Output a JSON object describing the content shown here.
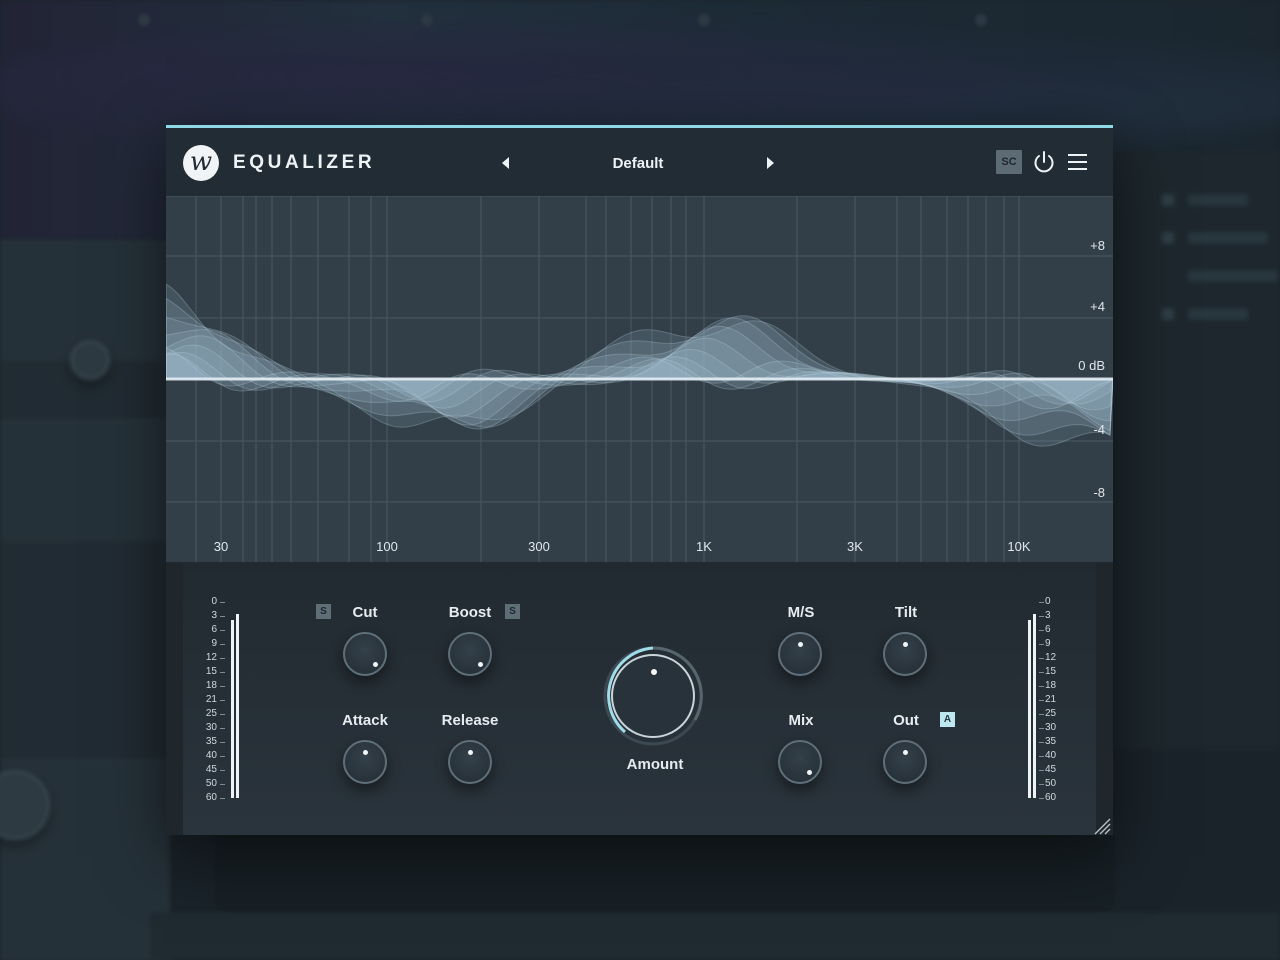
{
  "plugin": {
    "logo_glyph": "w",
    "title": "EQUALIZER",
    "preset": "Default",
    "sc_label": "SC",
    "accent_color": "#8fd8e6"
  },
  "graph": {
    "db_labels": [
      "+8",
      "+4",
      "0 dB",
      "-4",
      "-8"
    ],
    "freq_labels": [
      "30",
      "100",
      "300",
      "1K",
      "3K",
      "10K"
    ]
  },
  "controls": {
    "left_meter_scale": [
      "0",
      "3",
      "6",
      "9",
      "12",
      "15",
      "18",
      "21",
      "25",
      "30",
      "35",
      "40",
      "45",
      "50",
      "60"
    ],
    "right_meter_scale": [
      "0",
      "3",
      "6",
      "9",
      "12",
      "15",
      "18",
      "21",
      "25",
      "30",
      "35",
      "40",
      "45",
      "50",
      "60"
    ],
    "knobs": {
      "cut": {
        "label": "Cut",
        "badge": "S"
      },
      "boost": {
        "label": "Boost",
        "badge": "S"
      },
      "attack": {
        "label": "Attack"
      },
      "release": {
        "label": "Release"
      },
      "amount": {
        "label": "Amount"
      },
      "ms": {
        "label": "M/S"
      },
      "tilt": {
        "label": "Tilt"
      },
      "mix": {
        "label": "Mix"
      },
      "out": {
        "label": "Out",
        "badge": "A"
      }
    }
  }
}
